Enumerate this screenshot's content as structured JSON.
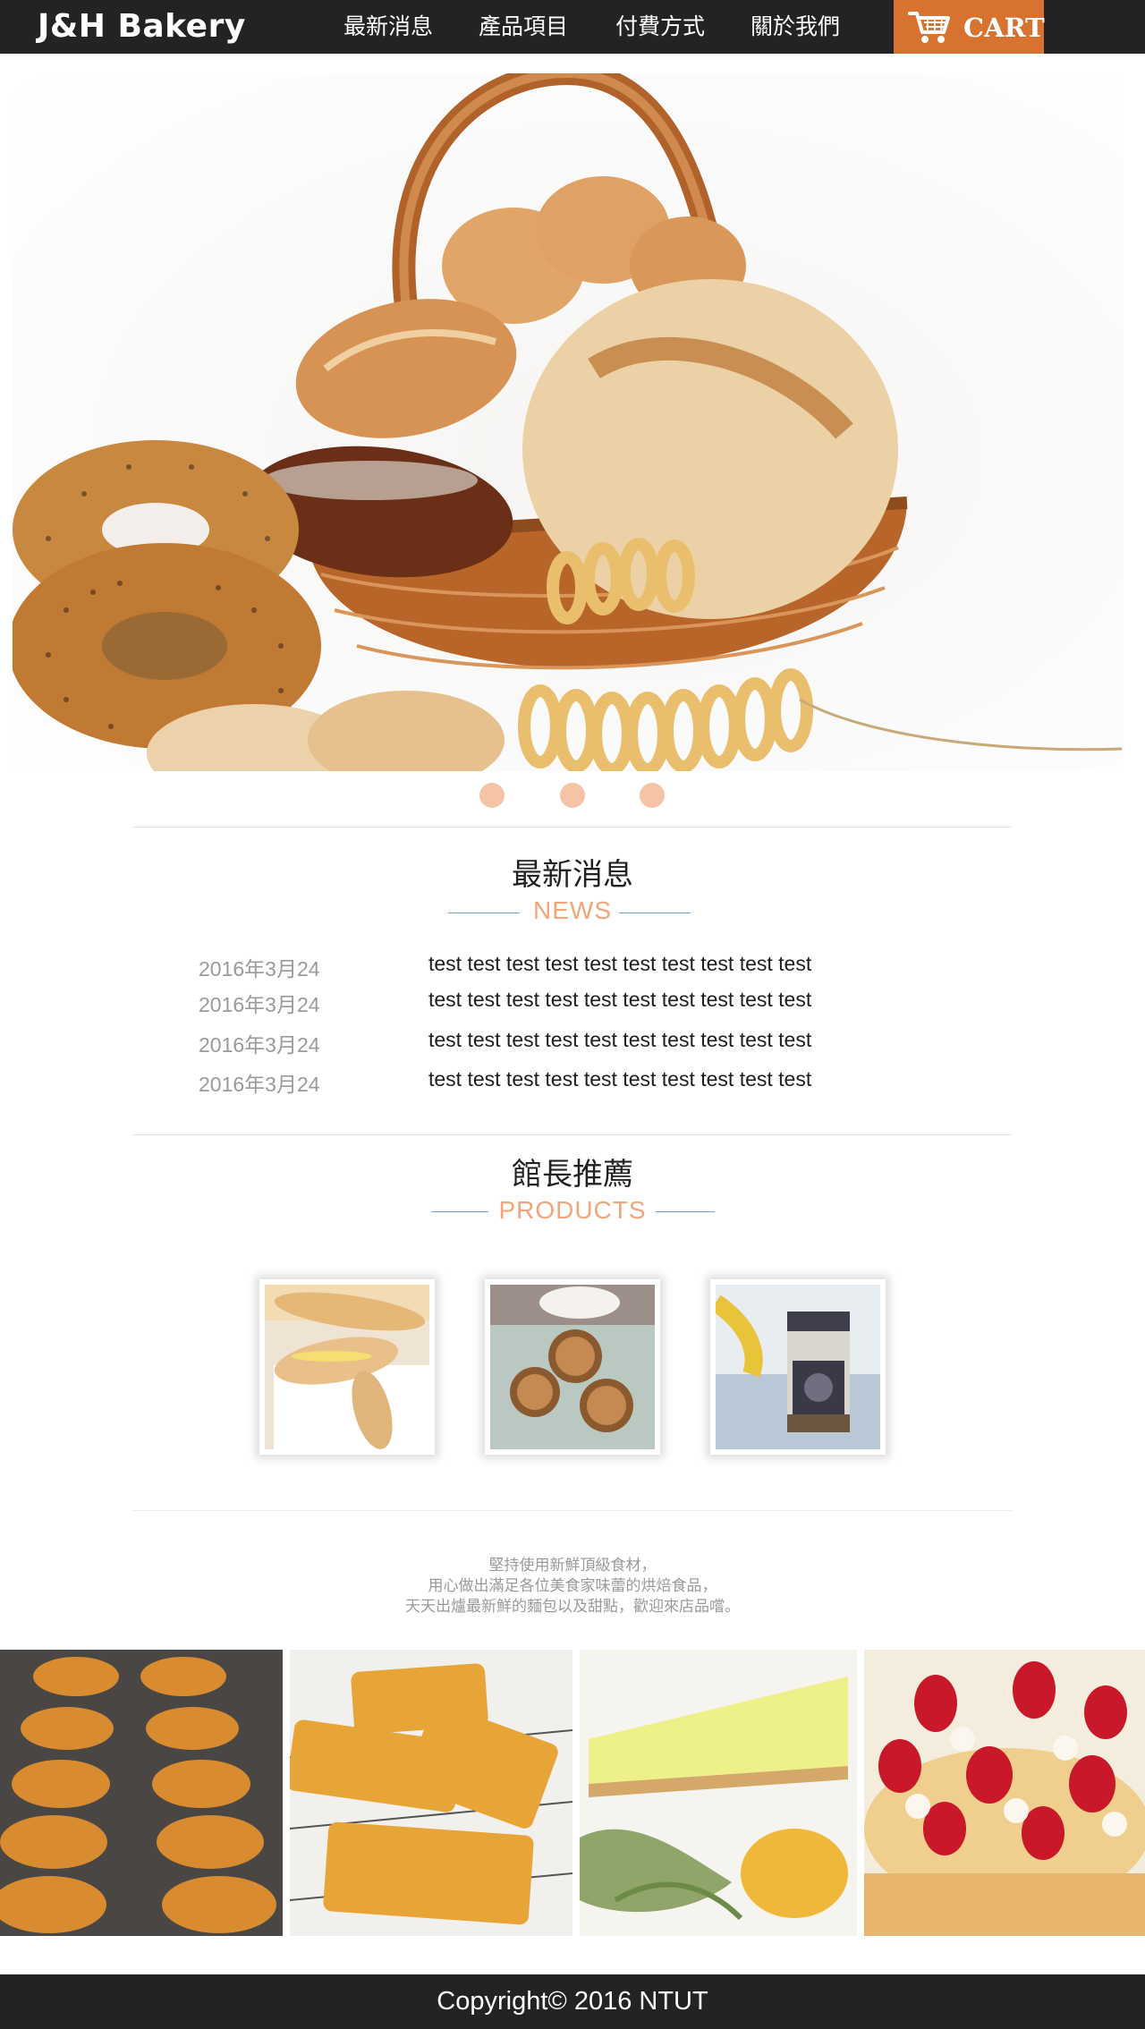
{
  "header": {
    "logo_text": "J&H Bakery",
    "nav": [
      {
        "label": "最新消息"
      },
      {
        "label": "產品項目"
      },
      {
        "label": "付費方式"
      },
      {
        "label": "關於我們"
      }
    ],
    "cart_label": "CART",
    "cart_icon": "shopping-cart-icon",
    "accent_color": "#d8722f"
  },
  "hero": {
    "image": "bread-basket-photo",
    "slides": 3
  },
  "news": {
    "title": "最新消息",
    "subtitle": "NEWS",
    "items": [
      {
        "date": "2016年3月24",
        "text": "test test test test test test test test test test"
      },
      {
        "date": "2016年3月24",
        "text": "test test test test test test test test test test"
      },
      {
        "date": "2016年3月24",
        "text": "test test test test test test test test test test"
      },
      {
        "date": "2016年3月24",
        "text": "test test test test test test test test test test"
      }
    ]
  },
  "products": {
    "title": "館長推薦",
    "subtitle": "PRODUCTS",
    "items": [
      {
        "image": "baguette-sandwich-photo"
      },
      {
        "image": "nut-tarts-photo"
      },
      {
        "image": "jar-and-bananas-photo"
      }
    ]
  },
  "tagline": {
    "lines": [
      "堅持使用新鮮頂級食材，",
      "用心做出滿足各位美食家味蕾的烘焙食品，",
      "天天出爐最新鮮的麵包以及甜點，歡迎來店品嚐。"
    ]
  },
  "gallery": [
    {
      "image": "madeleines-photo"
    },
    {
      "image": "pastries-photo"
    },
    {
      "image": "lemon-tart-photo"
    },
    {
      "image": "strawberry-crepe-cake-photo"
    }
  ],
  "footer": {
    "copyright": "Copyright© 2016 NTUT"
  }
}
